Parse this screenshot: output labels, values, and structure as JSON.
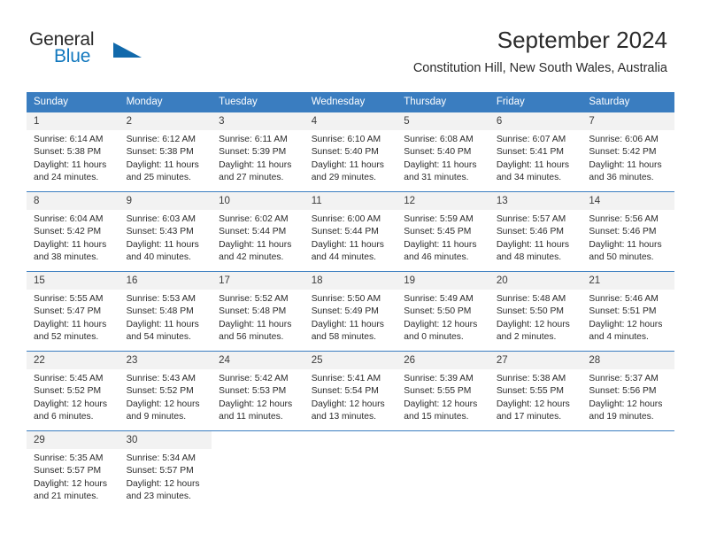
{
  "brand": {
    "name_part1": "General",
    "name_part2": "Blue",
    "triangle_icon": "brand-triangle-icon"
  },
  "header": {
    "month_title": "September 2024",
    "location": "Constitution Hill, New South Wales, Australia"
  },
  "colors": {
    "header_blue": "#3a7dc0",
    "daynum_bg": "#f2f2f2",
    "brand_blue": "#1278be",
    "text": "#2b2b2b"
  },
  "weekdays": [
    "Sunday",
    "Monday",
    "Tuesday",
    "Wednesday",
    "Thursday",
    "Friday",
    "Saturday"
  ],
  "weeks": [
    [
      {
        "day": "1",
        "sunrise": "Sunrise: 6:14 AM",
        "sunset": "Sunset: 5:38 PM",
        "daylight1": "Daylight: 11 hours",
        "daylight2": "and 24 minutes."
      },
      {
        "day": "2",
        "sunrise": "Sunrise: 6:12 AM",
        "sunset": "Sunset: 5:38 PM",
        "daylight1": "Daylight: 11 hours",
        "daylight2": "and 25 minutes."
      },
      {
        "day": "3",
        "sunrise": "Sunrise: 6:11 AM",
        "sunset": "Sunset: 5:39 PM",
        "daylight1": "Daylight: 11 hours",
        "daylight2": "and 27 minutes."
      },
      {
        "day": "4",
        "sunrise": "Sunrise: 6:10 AM",
        "sunset": "Sunset: 5:40 PM",
        "daylight1": "Daylight: 11 hours",
        "daylight2": "and 29 minutes."
      },
      {
        "day": "5",
        "sunrise": "Sunrise: 6:08 AM",
        "sunset": "Sunset: 5:40 PM",
        "daylight1": "Daylight: 11 hours",
        "daylight2": "and 31 minutes."
      },
      {
        "day": "6",
        "sunrise": "Sunrise: 6:07 AM",
        "sunset": "Sunset: 5:41 PM",
        "daylight1": "Daylight: 11 hours",
        "daylight2": "and 34 minutes."
      },
      {
        "day": "7",
        "sunrise": "Sunrise: 6:06 AM",
        "sunset": "Sunset: 5:42 PM",
        "daylight1": "Daylight: 11 hours",
        "daylight2": "and 36 minutes."
      }
    ],
    [
      {
        "day": "8",
        "sunrise": "Sunrise: 6:04 AM",
        "sunset": "Sunset: 5:42 PM",
        "daylight1": "Daylight: 11 hours",
        "daylight2": "and 38 minutes."
      },
      {
        "day": "9",
        "sunrise": "Sunrise: 6:03 AM",
        "sunset": "Sunset: 5:43 PM",
        "daylight1": "Daylight: 11 hours",
        "daylight2": "and 40 minutes."
      },
      {
        "day": "10",
        "sunrise": "Sunrise: 6:02 AM",
        "sunset": "Sunset: 5:44 PM",
        "daylight1": "Daylight: 11 hours",
        "daylight2": "and 42 minutes."
      },
      {
        "day": "11",
        "sunrise": "Sunrise: 6:00 AM",
        "sunset": "Sunset: 5:44 PM",
        "daylight1": "Daylight: 11 hours",
        "daylight2": "and 44 minutes."
      },
      {
        "day": "12",
        "sunrise": "Sunrise: 5:59 AM",
        "sunset": "Sunset: 5:45 PM",
        "daylight1": "Daylight: 11 hours",
        "daylight2": "and 46 minutes."
      },
      {
        "day": "13",
        "sunrise": "Sunrise: 5:57 AM",
        "sunset": "Sunset: 5:46 PM",
        "daylight1": "Daylight: 11 hours",
        "daylight2": "and 48 minutes."
      },
      {
        "day": "14",
        "sunrise": "Sunrise: 5:56 AM",
        "sunset": "Sunset: 5:46 PM",
        "daylight1": "Daylight: 11 hours",
        "daylight2": "and 50 minutes."
      }
    ],
    [
      {
        "day": "15",
        "sunrise": "Sunrise: 5:55 AM",
        "sunset": "Sunset: 5:47 PM",
        "daylight1": "Daylight: 11 hours",
        "daylight2": "and 52 minutes."
      },
      {
        "day": "16",
        "sunrise": "Sunrise: 5:53 AM",
        "sunset": "Sunset: 5:48 PM",
        "daylight1": "Daylight: 11 hours",
        "daylight2": "and 54 minutes."
      },
      {
        "day": "17",
        "sunrise": "Sunrise: 5:52 AM",
        "sunset": "Sunset: 5:48 PM",
        "daylight1": "Daylight: 11 hours",
        "daylight2": "and 56 minutes."
      },
      {
        "day": "18",
        "sunrise": "Sunrise: 5:50 AM",
        "sunset": "Sunset: 5:49 PM",
        "daylight1": "Daylight: 11 hours",
        "daylight2": "and 58 minutes."
      },
      {
        "day": "19",
        "sunrise": "Sunrise: 5:49 AM",
        "sunset": "Sunset: 5:50 PM",
        "daylight1": "Daylight: 12 hours",
        "daylight2": "and 0 minutes."
      },
      {
        "day": "20",
        "sunrise": "Sunrise: 5:48 AM",
        "sunset": "Sunset: 5:50 PM",
        "daylight1": "Daylight: 12 hours",
        "daylight2": "and 2 minutes."
      },
      {
        "day": "21",
        "sunrise": "Sunrise: 5:46 AM",
        "sunset": "Sunset: 5:51 PM",
        "daylight1": "Daylight: 12 hours",
        "daylight2": "and 4 minutes."
      }
    ],
    [
      {
        "day": "22",
        "sunrise": "Sunrise: 5:45 AM",
        "sunset": "Sunset: 5:52 PM",
        "daylight1": "Daylight: 12 hours",
        "daylight2": "and 6 minutes."
      },
      {
        "day": "23",
        "sunrise": "Sunrise: 5:43 AM",
        "sunset": "Sunset: 5:52 PM",
        "daylight1": "Daylight: 12 hours",
        "daylight2": "and 9 minutes."
      },
      {
        "day": "24",
        "sunrise": "Sunrise: 5:42 AM",
        "sunset": "Sunset: 5:53 PM",
        "daylight1": "Daylight: 12 hours",
        "daylight2": "and 11 minutes."
      },
      {
        "day": "25",
        "sunrise": "Sunrise: 5:41 AM",
        "sunset": "Sunset: 5:54 PM",
        "daylight1": "Daylight: 12 hours",
        "daylight2": "and 13 minutes."
      },
      {
        "day": "26",
        "sunrise": "Sunrise: 5:39 AM",
        "sunset": "Sunset: 5:55 PM",
        "daylight1": "Daylight: 12 hours",
        "daylight2": "and 15 minutes."
      },
      {
        "day": "27",
        "sunrise": "Sunrise: 5:38 AM",
        "sunset": "Sunset: 5:55 PM",
        "daylight1": "Daylight: 12 hours",
        "daylight2": "and 17 minutes."
      },
      {
        "day": "28",
        "sunrise": "Sunrise: 5:37 AM",
        "sunset": "Sunset: 5:56 PM",
        "daylight1": "Daylight: 12 hours",
        "daylight2": "and 19 minutes."
      }
    ],
    [
      {
        "day": "29",
        "sunrise": "Sunrise: 5:35 AM",
        "sunset": "Sunset: 5:57 PM",
        "daylight1": "Daylight: 12 hours",
        "daylight2": "and 21 minutes."
      },
      {
        "day": "30",
        "sunrise": "Sunrise: 5:34 AM",
        "sunset": "Sunset: 5:57 PM",
        "daylight1": "Daylight: 12 hours",
        "daylight2": "and 23 minutes."
      },
      {
        "day": "",
        "sunrise": "",
        "sunset": "",
        "daylight1": "",
        "daylight2": ""
      },
      {
        "day": "",
        "sunrise": "",
        "sunset": "",
        "daylight1": "",
        "daylight2": ""
      },
      {
        "day": "",
        "sunrise": "",
        "sunset": "",
        "daylight1": "",
        "daylight2": ""
      },
      {
        "day": "",
        "sunrise": "",
        "sunset": "",
        "daylight1": "",
        "daylight2": ""
      },
      {
        "day": "",
        "sunrise": "",
        "sunset": "",
        "daylight1": "",
        "daylight2": ""
      }
    ]
  ]
}
